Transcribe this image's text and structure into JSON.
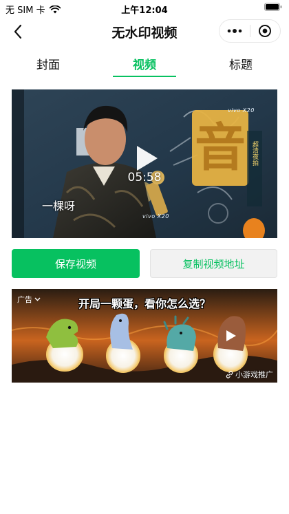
{
  "status_bar": {
    "carrier": "无 SIM 卡",
    "time": "上午12:04"
  },
  "nav": {
    "title": "无水印视频"
  },
  "tabs": [
    {
      "label": "封面",
      "active": false
    },
    {
      "label": "视频",
      "active": true
    },
    {
      "label": "标题",
      "active": false
    }
  ],
  "video": {
    "duration": "05:58",
    "subtitle": "一棵呀",
    "brand_watermark": "vivo X20"
  },
  "actions": {
    "save_label": "保存视频",
    "copy_label": "复制视频地址"
  },
  "ad": {
    "label": "广告",
    "headline": "开局一颗蛋，看你怎么选？",
    "promo": "小游戏推广"
  },
  "colors": {
    "accent": "#07c160",
    "text": "#111111",
    "button_secondary_bg": "#f2f2f2"
  }
}
